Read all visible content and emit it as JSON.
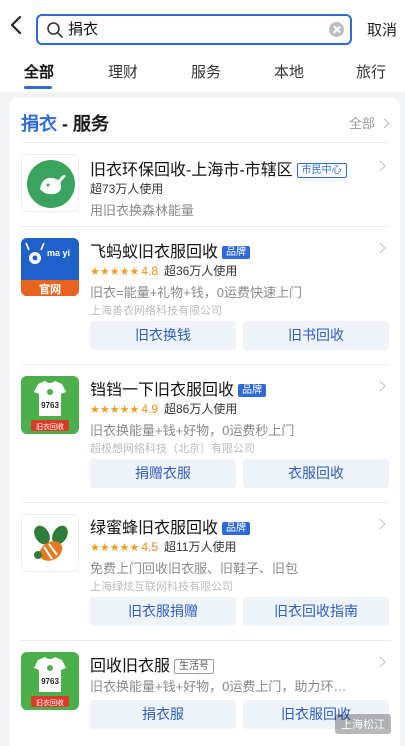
{
  "search": {
    "query": "捐衣",
    "cancel_label": "取消"
  },
  "tabs": [
    "全部",
    "理财",
    "服务",
    "本地",
    "旅行"
  ],
  "section": {
    "keyword": "捐衣",
    "suffix": " - 服务",
    "all_label": "全部"
  },
  "items": [
    {
      "name": "旧衣环保回收-上海市-市辖区",
      "badge": "市民中心",
      "users": "超73万人使用",
      "desc": "用旧衣换森林能量",
      "logo": "green-whale-logo"
    },
    {
      "name": "飞蚂蚁旧衣服回收",
      "badge": "品牌",
      "rating": "4.8",
      "users": "超36万人使用",
      "desc": "旧衣=能量+礼物+钱，0运费快速上门",
      "company": "上海善衣网络科技有限公司",
      "buttons": [
        "旧衣换钱",
        "旧书回收"
      ],
      "logo": "ant-logo",
      "logo_text_top": "ma yi",
      "logo_text_bottom": "官网"
    },
    {
      "name": "铛铛一下旧衣服回收",
      "badge": "品牌",
      "rating": "4.9",
      "users": "超86万人使用",
      "desc": "旧衣换能量+钱+好物，0运费秒上门",
      "company": "超极想网络科技（北京）有限公司",
      "buttons": [
        "捐赠衣服",
        "衣服回收"
      ],
      "logo": "shirt-recycle-logo",
      "logo_num": "9763",
      "logo_caption": "旧衣回收"
    },
    {
      "name": "绿蜜蜂旧衣服回收",
      "badge": "品牌",
      "rating": "4.5",
      "users": "超11万人使用",
      "desc": "免费上门回收旧衣服、旧鞋子、旧包",
      "company": "上海绿炫互联网科技有限公司",
      "buttons": [
        "旧衣服捐赠",
        "旧衣回收指南"
      ],
      "logo": "bee-logo"
    },
    {
      "name": "回收旧衣服",
      "badge": "生活号",
      "desc": "旧衣换能量+钱+好物，0运费上门，助力环…",
      "buttons": [
        "捐衣服",
        "旧衣服回收"
      ],
      "logo": "shirt-recycle-logo",
      "logo_num": "9763",
      "logo_caption": "旧衣回收"
    }
  ],
  "watermark": "上海松江",
  "colors": {
    "accent": "#2f6ad9",
    "star": "#f39c24",
    "button_bg": "#eef2f9"
  }
}
